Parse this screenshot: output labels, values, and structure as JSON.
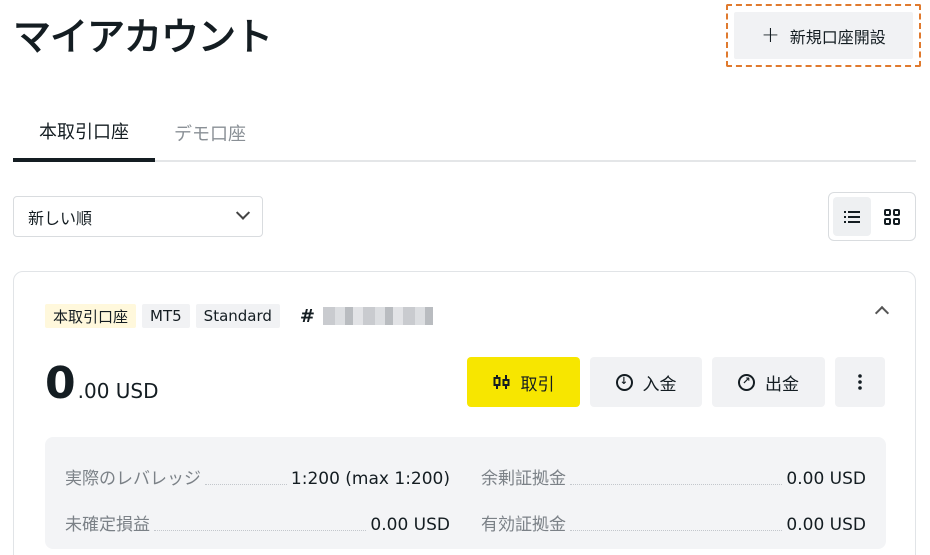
{
  "header": {
    "title": "マイアカウント",
    "new_account_label": "新規口座開設"
  },
  "tabs": [
    {
      "label": "本取引口座",
      "active": true
    },
    {
      "label": "デモ口座",
      "active": false
    }
  ],
  "sort": {
    "selected": "新しい順"
  },
  "view_toggle": {
    "selected": "list"
  },
  "account": {
    "tags": [
      "本取引口座",
      "MT5",
      "Standard"
    ],
    "number_prefix": "#",
    "balance_int": "0",
    "balance_dec": ".00 USD",
    "actions": {
      "trade": "取引",
      "deposit": "入金",
      "withdraw": "出金"
    },
    "details": {
      "leverage_label": "実際のレバレッジ",
      "leverage_value": "1:200 (max 1:200)",
      "free_margin_label": "余剰証拠金",
      "free_margin_value": "0.00 USD",
      "unrealized_pl_label": "未確定損益",
      "unrealized_pl_value": "0.00 USD",
      "equity_label": "有効証拠金",
      "equity_value": "0.00 USD"
    }
  },
  "colors": {
    "accent_yellow": "#f7e600",
    "highlight_orange": "#e07a2e",
    "text": "#141d22",
    "muted": "#8a9096"
  }
}
